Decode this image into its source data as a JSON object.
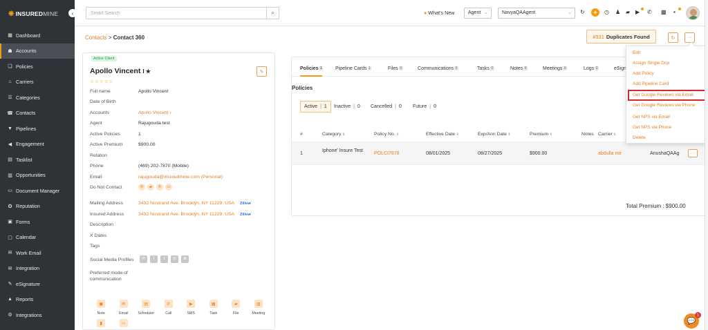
{
  "brand": {
    "part1": "INSURED",
    "part2": "MINE"
  },
  "sidebar": {
    "items": [
      {
        "label": "Dashboard",
        "icon": "dashboard-icon",
        "glyph": "▦"
      },
      {
        "label": "Accounts",
        "icon": "accounts-icon",
        "glyph": "☗",
        "active": true
      },
      {
        "label": "Policies",
        "icon": "policies-icon",
        "glyph": "❏"
      },
      {
        "label": "Carriers",
        "icon": "carriers-icon",
        "glyph": "⌂"
      },
      {
        "label": "Categories",
        "icon": "categories-icon",
        "glyph": "☰"
      },
      {
        "label": "Contacts",
        "icon": "contacts-icon",
        "glyph": "☎"
      },
      {
        "label": "Pipelines",
        "icon": "pipelines-icon",
        "glyph": "▼"
      },
      {
        "label": "Engagement",
        "icon": "engagement-icon",
        "glyph": "◀"
      },
      {
        "label": "Tasklist",
        "icon": "tasklist-icon",
        "glyph": "▤"
      },
      {
        "label": "Opportunities",
        "icon": "opportunities-icon",
        "glyph": "▥"
      },
      {
        "label": "Document Manager",
        "icon": "document-manager-icon",
        "glyph": "▭"
      },
      {
        "label": "Reputation",
        "icon": "reputation-icon",
        "glyph": "✪"
      },
      {
        "label": "Forms",
        "icon": "forms-icon",
        "glyph": "▣"
      },
      {
        "label": "Calendar",
        "icon": "calendar-icon",
        "glyph": "▢"
      },
      {
        "label": "Work Email",
        "icon": "work-email-icon",
        "glyph": "✉"
      },
      {
        "label": "Integration",
        "icon": "integration-icon",
        "glyph": "✉"
      },
      {
        "label": "eSignature",
        "icon": "esignature-icon",
        "glyph": "✎"
      },
      {
        "label": "Reports",
        "icon": "reports-icon",
        "glyph": "▲"
      },
      {
        "label": "Integrations",
        "icon": "integrations-icon",
        "glyph": "⚙"
      }
    ]
  },
  "topbar": {
    "search_placeholder": "Smart Search",
    "whats_new": "What's New",
    "role_select": "Agent",
    "agent_select": "NavyaQAAgent"
  },
  "header": {
    "crumb_parent": "Contacts",
    "crumb_sep": ">",
    "crumb_current": "Contact 360",
    "duplicates_num": "#331",
    "duplicates_label": "Duplicates Found"
  },
  "contact": {
    "badge": "Active Client",
    "name": "Apollo Vincent",
    "name_suffix": "I ★",
    "stars": "☆☆☆☆☆",
    "fields": [
      {
        "label": "Full name",
        "value": "Apollo Vincent"
      },
      {
        "label": "Date of Birth",
        "value": ""
      },
      {
        "label": "Accounts",
        "value": "Apollo Vincent ›",
        "link": true
      },
      {
        "label": "Agent",
        "value": "Rajugouda test"
      },
      {
        "label": "Active Policies",
        "value": "1"
      },
      {
        "label": "Active Premium",
        "value": "$900.00"
      },
      {
        "label": "Relation",
        "value": ""
      },
      {
        "label": "Phone",
        "value": "(469) 202-7870 (Mobile)"
      },
      {
        "label": "Email",
        "value": "rajugouda@insuredmine.com (Personal)",
        "link": true
      },
      {
        "label": "Do Not Contact",
        "value": ""
      },
      {
        "label": "Mailing Address",
        "value": "3432 Nostrand Ave, Brooklyn, NY 11229, USA",
        "link": true,
        "zillow": "Zillow"
      },
      {
        "label": "Insured Address",
        "value": "3432 Nostrand Ave, Brooklyn, NY 11229, USA",
        "link": true,
        "zillow": "Zillow"
      },
      {
        "label": "Description",
        "value": ""
      },
      {
        "label": "X Dates",
        "value": ""
      },
      {
        "label": "Tags",
        "value": ""
      },
      {
        "label": "Social Media Profiles",
        "value": ""
      },
      {
        "label": "Preferred mode of communication",
        "value": ""
      }
    ],
    "actions": [
      "Note",
      "Email",
      "Scheduler",
      "Call",
      "SMS",
      "Task",
      "File",
      "Meeting",
      "",
      ""
    ]
  },
  "tabs": [
    {
      "label": "Policies",
      "count": "1"
    },
    {
      "label": "Pipeline Cards",
      "count": "1"
    },
    {
      "label": "Files",
      "count": "0"
    },
    {
      "label": "Communications",
      "count": "0"
    },
    {
      "label": "Tasks",
      "count": "0"
    },
    {
      "label": "Notes",
      "count": "0"
    },
    {
      "label": "Meetings",
      "count": "0"
    },
    {
      "label": "Logs",
      "count": "0"
    },
    {
      "label": "eSign",
      "count": ""
    }
  ],
  "policies": {
    "title": "Policies",
    "filters": [
      {
        "label": "Active",
        "count": "1"
      },
      {
        "label": "Inactive",
        "count": "0"
      },
      {
        "label": "Cancelled",
        "count": "0"
      },
      {
        "label": "Future",
        "count": "0"
      }
    ],
    "columns": [
      "#",
      "Category",
      "Policy No.",
      "Effective Date",
      "Exp/Ann Date",
      "Premium",
      "Notes",
      "Carrier"
    ],
    "row": {
      "num": "1",
      "category": "Iphone' Insure Test",
      "policy_no": "POLCI7878",
      "effective": "08/01/2025",
      "exp": "08/27/2025",
      "premium": "$900.00",
      "carrier": "abdulla mir",
      "agent": "AnushaQAAg"
    },
    "total_label": "Total Premium : $900.00"
  },
  "dropdown": {
    "items": [
      "Edit",
      "Assign Single Drip",
      "Add Policy",
      "Add Pipeline Card",
      "Get Google Reviews via Email",
      "Get Google Reviews via Phone",
      "Get NPS via Email",
      "Get NPS via Phone",
      "Delete"
    ],
    "highlighted": "Get Google Reviews via Email"
  },
  "chat_badge": "1",
  "colors": {
    "accent": "#f39c12",
    "link": "#e67e22",
    "sidebar": "#2e3338",
    "highlight": "#d9252e"
  }
}
